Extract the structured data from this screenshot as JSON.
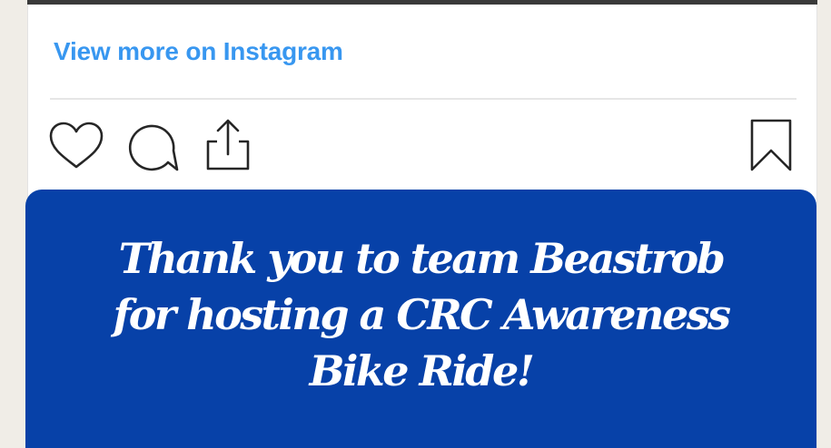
{
  "post": {
    "view_more_label": "View more on Instagram",
    "link_color": "#3897f0",
    "actions": {
      "like_icon": "heart-icon",
      "comment_icon": "comment-icon",
      "share_icon": "share-icon",
      "save_icon": "bookmark-icon"
    }
  },
  "banner": {
    "message": "Thank  you to team  Beastrob\nfor hosting a CRC Awareness\nBike Ride!",
    "background_color": "#0741a8",
    "text_color": "#ffffff"
  }
}
